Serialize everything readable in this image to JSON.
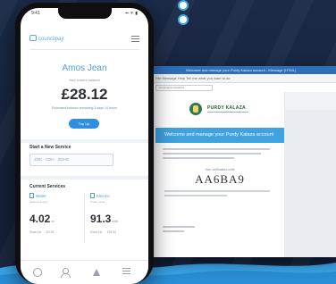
{
  "colors": {
    "accent": "#4d9fd9",
    "button": "#2f8ee0",
    "band": "#3ea3e0",
    "background": "#16233c"
  },
  "phone": {
    "status": {
      "time": "9:41",
      "signal": "▪▪ ᯤ ▮"
    },
    "brand": "councilpay",
    "greeting": "Amos Jean",
    "balance_label": "Your current balance",
    "balance": "£28.12",
    "balance_note": "Estimated balance remaining 3 days 14 hours",
    "topup_label": "Top Up",
    "start_label": "Start a New Service",
    "start_placeholder": "ZNK · CBH · ZDHG",
    "current_label": "Current Services",
    "services": [
      {
        "name": "Water",
        "sub": "Metered supply",
        "value": "4.02",
        "unit": "m³",
        "foot1": "Since 1st",
        "foot2": "£3.18"
      },
      {
        "name": "Electric",
        "sub": "Smart meter",
        "value": "91.3",
        "unit": "kWh",
        "foot1": "Since 1st",
        "foot2": "£24.94"
      }
    ],
    "tabs": [
      "home-icon",
      "user-icon",
      "alert-icon",
      "menu-icon"
    ]
  },
  "laptop": {
    "window_title": "Welcome and manage your Purdy Kalaza account - Message (HTML)",
    "menu": "File   Message   Help   Tell me what you want to do",
    "address": "noreply@purdykalaza",
    "logo_text": "PURDY KALAZA",
    "welcome": "Welcome and manage your Purdy Kalaza account",
    "code_label": "Your verification code",
    "code": "AA6BA9"
  }
}
